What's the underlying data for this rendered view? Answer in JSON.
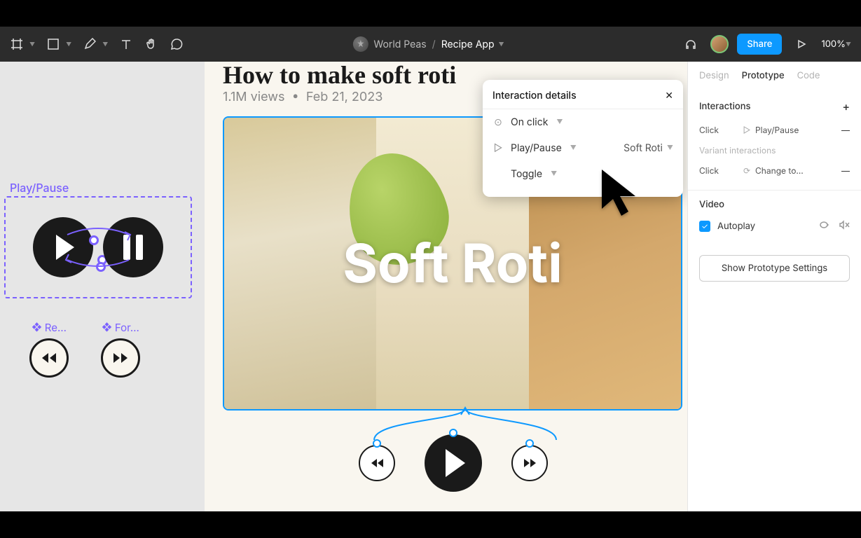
{
  "toolbar": {
    "team": "World Peas",
    "file": "Recipe App",
    "share": "Share",
    "zoom": "100%"
  },
  "canvas": {
    "component_label": "Play/Pause",
    "sub_rewind": "Re…",
    "sub_forward": "For…"
  },
  "page": {
    "title": "How to make soft roti",
    "views": "1.1M views",
    "sep": "•",
    "date": "Feb 21, 2023",
    "video_text": "Soft Roti"
  },
  "popover": {
    "title": "Interaction details",
    "trigger": "On click",
    "action": "Play/Pause",
    "target": "Soft Roti",
    "mode": "Toggle"
  },
  "panel": {
    "tabs": {
      "design": "Design",
      "prototype": "Prototype",
      "code": "Code"
    },
    "interactions": {
      "title": "Interactions",
      "row1": {
        "trigger": "Click",
        "action": "Play/Pause"
      },
      "variant_label": "Variant interactions",
      "row2": {
        "trigger": "Click",
        "action": "Change to…"
      }
    },
    "video": {
      "title": "Video",
      "autoplay": "Autoplay"
    },
    "settings_btn": "Show Prototype Settings"
  }
}
